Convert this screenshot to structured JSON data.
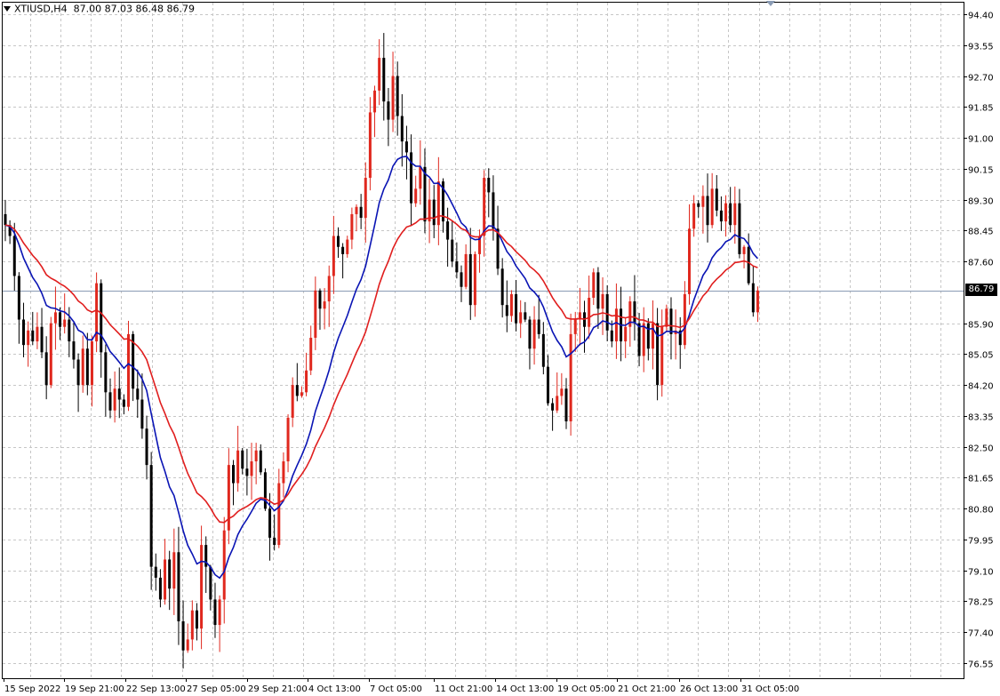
{
  "header": {
    "symbol_timeframe": "XTIUSD,H4",
    "ohlc": "87.00 87.03 86.48 86.79"
  },
  "current_price_label": "86.79",
  "colors": {
    "bull": "#e0281e",
    "bear": "#000000",
    "ma_fast": "#0a14b4",
    "ma_slow": "#e01e1e",
    "grid": "#c6c6c6",
    "price_line": "#8a9bb4"
  },
  "chart_data": {
    "type": "candlestick",
    "y_ticks": [
      "94.40",
      "93.55",
      "92.70",
      "91.85",
      "91.00",
      "90.15",
      "89.30",
      "88.45",
      "87.60",
      "86.79",
      "85.90",
      "85.05",
      "84.20",
      "83.35",
      "82.50",
      "81.65",
      "80.80",
      "79.95",
      "79.10",
      "78.25",
      "77.40",
      "76.55"
    ],
    "ylim": [
      76.15,
      94.7
    ],
    "x_labels": [
      "15 Sep 2022",
      "19 Sep 21:00",
      "22 Sep 13:00",
      "27 Sep 05:00",
      "29 Sep 21:00",
      "4 Oct 13:00",
      "7 Oct 05:00",
      "11 Oct 21:00",
      "14 Oct 13:00",
      "19 Oct 05:00",
      "21 Oct 21:00",
      "26 Oct 13:00",
      "31 Oct 05:00"
    ],
    "last_price": 86.79,
    "series_close": [
      88.6,
      88.3,
      87.2,
      86.0,
      85.3,
      85.7,
      85.4,
      85.8,
      85.1,
      84.2,
      85.9,
      86.2,
      85.8,
      86.0,
      85.4,
      84.9,
      84.2,
      85.2,
      84.2,
      85.4,
      87.0,
      85.1,
      84.0,
      83.5,
      84.1,
      83.8,
      83.6,
      85.6,
      84.1,
      83.8,
      83.0,
      82.0,
      79.2,
      78.9,
      78.3,
      79.4,
      78.6,
      79.6,
      77.7,
      76.9,
      77.2,
      78.0,
      77.5,
      79.8,
      79.2,
      78.3,
      77.6,
      78.3,
      80.2,
      82.0,
      81.5,
      82.4,
      81.9,
      81.7,
      82.1,
      82.4,
      81.8,
      80.8,
      80.0,
      79.8,
      81.5,
      82.1,
      83.3,
      84.2,
      83.9,
      84.0,
      84.6,
      85.5,
      86.8,
      86.3,
      86.5,
      87.2,
      88.3,
      88.0,
      87.8,
      88.2,
      88.9,
      89.1,
      88.8,
      89.9,
      91.7,
      92.3,
      93.2,
      92.0,
      91.5,
      92.7,
      91.6,
      90.9,
      90.6,
      89.2,
      89.6,
      90.2,
      88.7,
      89.3,
      88.6,
      89.8,
      88.7,
      88.2,
      87.6,
      87.3,
      86.9,
      87.8,
      86.4,
      87.8,
      88.3,
      89.9,
      89.5,
      88.5,
      87.4,
      86.4,
      86.1,
      86.7,
      85.9,
      86.2,
      86.0,
      85.2,
      86.0,
      85.6,
      84.7,
      83.7,
      83.5,
      83.9,
      84.1,
      83.2,
      85.6,
      86.0,
      86.2,
      85.8,
      86.6,
      87.3,
      86.3,
      86.7,
      85.7,
      85.4,
      86.3,
      85.4,
      85.8,
      86.5,
      85.9,
      85.0,
      85.9,
      85.2,
      85.9,
      84.2,
      85.8,
      86.3,
      85.6,
      85.7,
      85.3,
      86.7,
      88.5,
      89.2,
      89.1,
      89.4,
      88.6,
      89.6,
      89.0,
      88.7,
      89.2,
      88.6,
      89.2,
      87.8,
      88.0,
      87.0,
      86.2,
      86.8
    ]
  }
}
